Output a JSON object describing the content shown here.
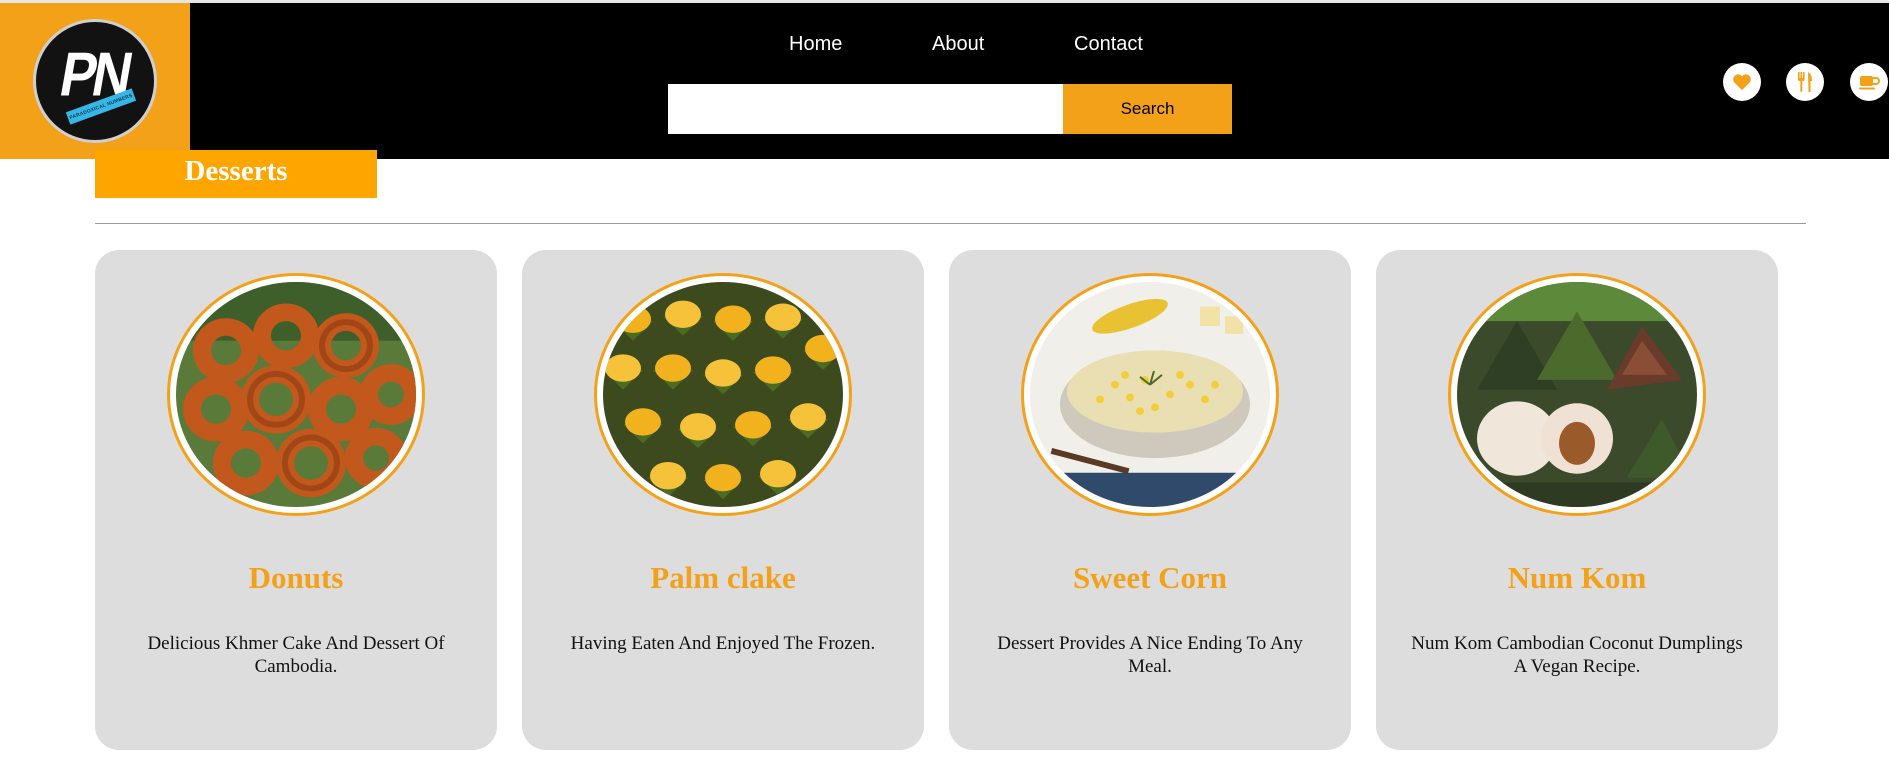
{
  "brand": {
    "logo_text": "PN",
    "logo_ribbon_text": "PARADOXICAL NUMBERS",
    "accent_color": "#f4a11a",
    "header_color": "#000000"
  },
  "nav": {
    "home": "Home",
    "about": "About",
    "contact": "Contact"
  },
  "search": {
    "value": "",
    "placeholder": "",
    "button_label": "Search"
  },
  "header_icons": [
    "heart-icon",
    "utensils-icon",
    "coffee-cup-icon"
  ],
  "section": {
    "title": "Desserts"
  },
  "cards": [
    {
      "title": "Donuts",
      "description": "Delicious Khmer Cake And Dessert Of Cambodia.",
      "image": "donuts-photo"
    },
    {
      "title": "Palm clake",
      "description": "Having Eaten And Enjoyed The Frozen.",
      "image": "palm-cake-photo"
    },
    {
      "title": "Sweet Corn",
      "description": "Dessert Provides A Nice Ending To Any Meal.",
      "image": "sweet-corn-photo"
    },
    {
      "title": "Num Kom",
      "description": "Num Kom Cambodian Coconut Dumplings A Vegan Recipe.",
      "image": "num-kom-photo"
    }
  ]
}
